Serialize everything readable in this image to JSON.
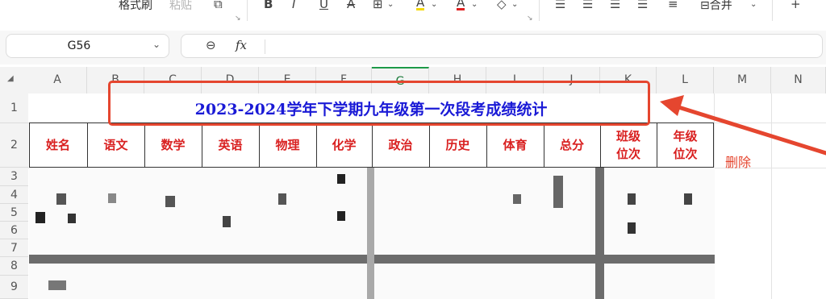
{
  "toolbar": {
    "format_painter": "格式刷",
    "paste": "粘贴",
    "merge_label": "合并",
    "bold": "B",
    "italic": "I",
    "underline": "U",
    "strikethrough": "A",
    "borders": "⊞",
    "fill_color": "A",
    "font_color": "A",
    "clear": "◇",
    "align_left": "☰",
    "align_center": "☰",
    "align_right": "☰",
    "wrap": "≡",
    "more": "+"
  },
  "formula_bar": {
    "cell_ref": "G56",
    "zoom_icon": "⊖",
    "fx": "fx",
    "formula_value": ""
  },
  "columns": [
    "A",
    "B",
    "C",
    "D",
    "E",
    "F",
    "G",
    "H",
    "I",
    "J",
    "K",
    "L",
    "M",
    "N"
  ],
  "selected_column": "G",
  "rows": [
    "1",
    "2",
    "3",
    "4",
    "5",
    "6",
    "7",
    "8",
    "9"
  ],
  "sheet": {
    "title": "2023-2024学年下学期九年级第一次段考成绩统计",
    "headers": [
      {
        "lines": [
          "姓名"
        ]
      },
      {
        "lines": [
          "语文"
        ]
      },
      {
        "lines": [
          "数学"
        ]
      },
      {
        "lines": [
          "英语"
        ]
      },
      {
        "lines": [
          "物理"
        ]
      },
      {
        "lines": [
          "化学"
        ]
      },
      {
        "lines": [
          "政治"
        ]
      },
      {
        "lines": [
          "历史"
        ]
      },
      {
        "lines": [
          "体育"
        ]
      },
      {
        "lines": [
          "总分"
        ]
      },
      {
        "lines": [
          "班级",
          "位次"
        ]
      },
      {
        "lines": [
          "年级",
          "位次"
        ]
      }
    ]
  },
  "annotation": {
    "label": "删除",
    "color": "#e5462f"
  },
  "colors": {
    "title_blue": "#1a1ad6",
    "header_red": "#d92020",
    "selection_green": "#1e9a49"
  }
}
